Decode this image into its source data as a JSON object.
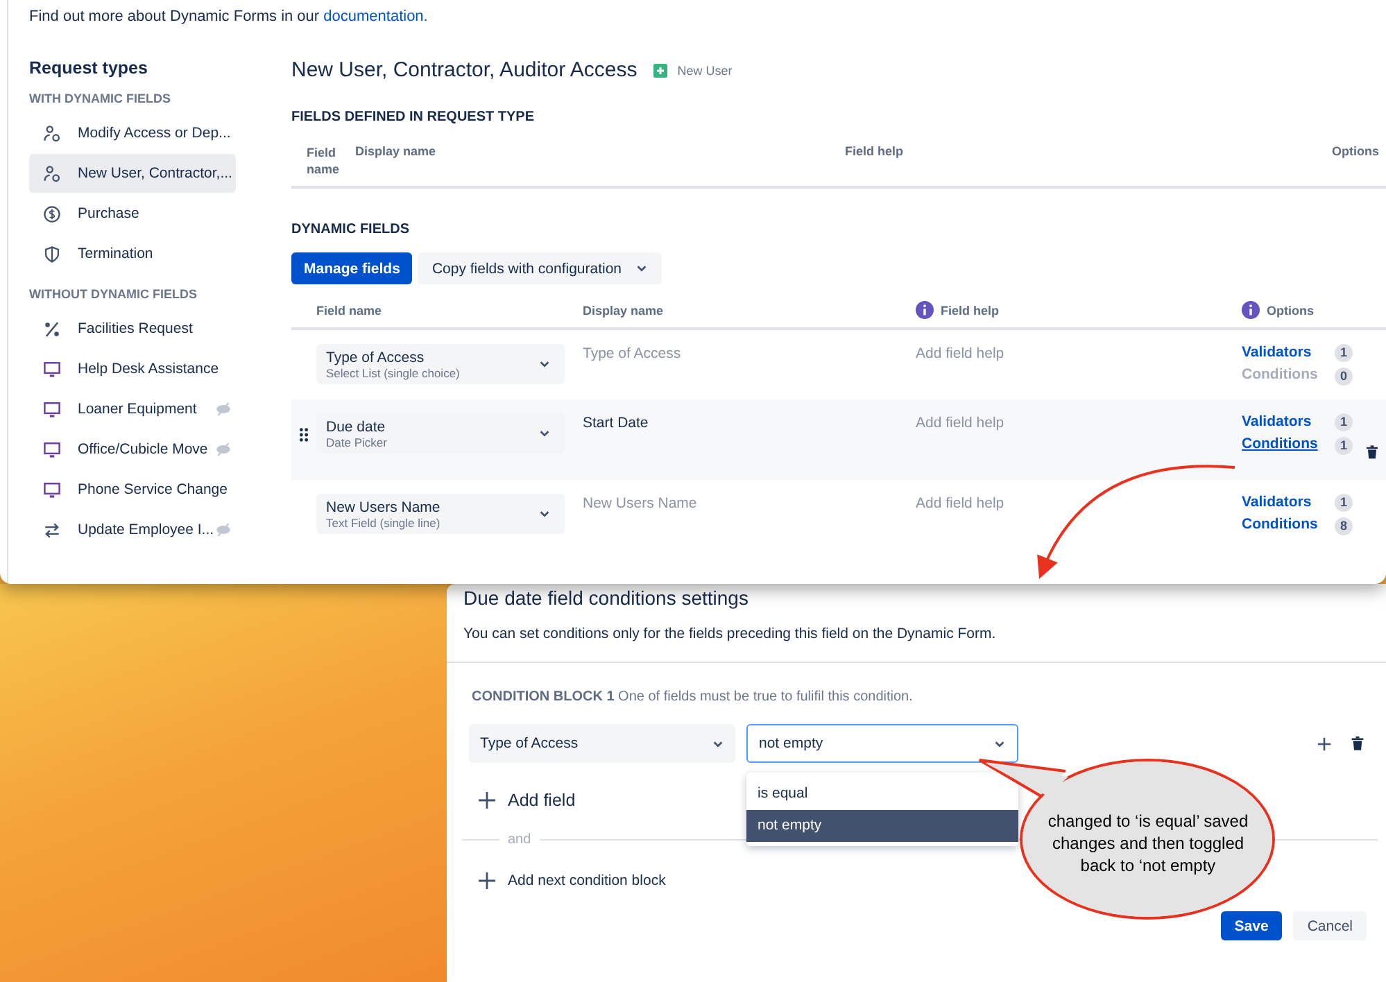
{
  "intro": {
    "text": "Find out more about Dynamic Forms in our",
    "link": "documentation."
  },
  "sidebar": {
    "title": "Request types",
    "groups": [
      {
        "heading": "WITH DYNAMIC FIELDS",
        "items": [
          {
            "label": "Modify Access or Dep...",
            "kind": "person",
            "selected": false,
            "hidden": false
          },
          {
            "label": "New User, Contractor,...",
            "kind": "person",
            "selected": true,
            "hidden": false
          },
          {
            "label": "Purchase",
            "kind": "dollar",
            "selected": false,
            "hidden": false
          },
          {
            "label": "Termination",
            "kind": "shield",
            "selected": false,
            "hidden": false
          }
        ]
      },
      {
        "heading": "WITHOUT DYNAMIC FIELDS",
        "items": [
          {
            "label": "Facilities Request",
            "kind": "percent",
            "selected": false,
            "hidden": false
          },
          {
            "label": "Help Desk Assistance",
            "kind": "monitor",
            "selected": false,
            "hidden": false
          },
          {
            "label": "Loaner Equipment",
            "kind": "monitor",
            "selected": false,
            "hidden": true
          },
          {
            "label": "Office/Cubicle Move",
            "kind": "monitor",
            "selected": false,
            "hidden": true
          },
          {
            "label": "Phone Service Change",
            "kind": "monitor",
            "selected": false,
            "hidden": false
          },
          {
            "label": "Update Employee I...",
            "kind": "arrows",
            "selected": false,
            "hidden": true
          }
        ]
      }
    ]
  },
  "main": {
    "title": "New User, Contractor, Auditor Access",
    "badge": "New User",
    "defined": {
      "heading": "FIELDS DEFINED IN REQUEST TYPE",
      "columns": [
        "Field name",
        "Display name",
        "Field help",
        "Options"
      ]
    },
    "dynamic": {
      "heading": "DYNAMIC FIELDS",
      "primary_button": "Manage fields",
      "copy_button": "Copy fields with configuration",
      "columns": [
        {
          "label": "Field name",
          "info": false
        },
        {
          "label": "Display name",
          "info": false
        },
        {
          "label": "Field help",
          "info": true
        },
        {
          "label": "Options",
          "info": true
        }
      ],
      "rows": [
        {
          "name": "Type of Access",
          "type": "Select List (single choice)",
          "display": {
            "placeholder": "Type of Access"
          },
          "help": {
            "placeholder": "Add field help"
          },
          "validators": {
            "label": "Validators",
            "count": "1"
          },
          "conditions": {
            "label": "Conditions",
            "count": "0",
            "disabled": true,
            "selected": false
          },
          "selected": false
        },
        {
          "name": "Due date",
          "type": "Date Picker",
          "display": {
            "value": "Start Date"
          },
          "help": {
            "placeholder": "Add field help"
          },
          "validators": {
            "label": "Validators",
            "count": "1"
          },
          "conditions": {
            "label": "Conditions",
            "count": "1",
            "disabled": false,
            "selected": true
          },
          "selected": true
        },
        {
          "name": "New Users Name",
          "type": "Text Field (single line)",
          "display": {
            "placeholder": "New Users Name"
          },
          "help": {
            "placeholder": "Add field help"
          },
          "validators": {
            "label": "Validators",
            "count": "1"
          },
          "conditions": {
            "label": "Conditions",
            "count": "8",
            "disabled": false,
            "selected": false
          },
          "selected": false
        }
      ]
    }
  },
  "dialog": {
    "title": "Due date field conditions settings",
    "description": "You can set conditions only for the fields preceding this field on the Dynamic Form.",
    "block": {
      "label": "CONDITION BLOCK 1",
      "text": "One of fields must be true to fulifil this condition."
    },
    "field_select": "Type of Access",
    "operator_select": {
      "value": "not empty",
      "focused": true
    },
    "options": [
      {
        "label": "is equal",
        "selected": false
      },
      {
        "label": "not empty",
        "selected": true
      }
    ],
    "add_field": "Add field",
    "and_label": "and",
    "add_block": "Add next condition block",
    "buttons": [
      {
        "label": "Save",
        "kind": "primary"
      },
      {
        "label": "Cancel",
        "kind": "secondary"
      }
    ]
  },
  "callout": {
    "text": "changed to ‘is equal’ saved changes and then toggled back to ‘not empty"
  }
}
